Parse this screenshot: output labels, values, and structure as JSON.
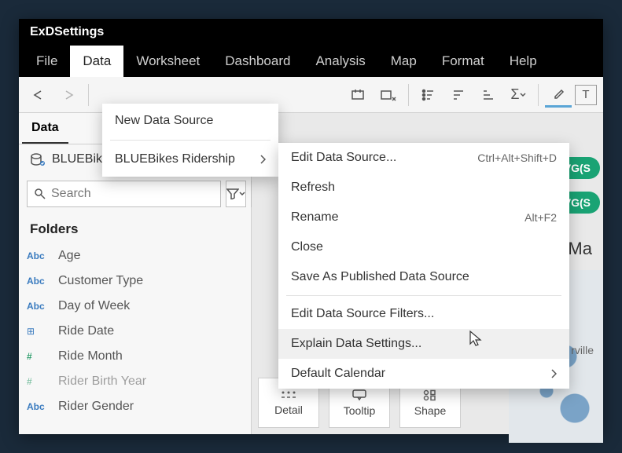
{
  "window": {
    "title": "ExDSettings"
  },
  "menubar": [
    "File",
    "Data",
    "Worksheet",
    "Dashboard",
    "Analysis",
    "Map",
    "Format",
    "Help"
  ],
  "menubar_active_index": 1,
  "sidebar": {
    "tab": "Data",
    "datasource": "BLUEBikes Ridership",
    "search_placeholder": "Search",
    "folders_label": "Folders",
    "fields": [
      {
        "type": "Abc",
        "cls": "abc",
        "label": "Age"
      },
      {
        "type": "Abc",
        "cls": "abc",
        "label": "Customer Type"
      },
      {
        "type": "Abc",
        "cls": "abc",
        "label": "Day of Week"
      },
      {
        "type": "⊞",
        "cls": "date",
        "label": "Ride Date"
      },
      {
        "type": "#",
        "cls": "hash",
        "label": "Ride Month"
      },
      {
        "type": "#",
        "cls": "hash",
        "label": "Rider Birth Year"
      },
      {
        "type": "Abc",
        "cls": "abc",
        "label": "Rider Gender"
      }
    ]
  },
  "data_menu": {
    "items": [
      {
        "label": "New Data Source"
      },
      {
        "label": "BLUEBikes Ridership",
        "submenu": true
      }
    ]
  },
  "submenu": {
    "items": [
      {
        "label": "Edit Data Source...",
        "shortcut": "Ctrl+Alt+Shift+D"
      },
      {
        "label": "Refresh"
      },
      {
        "label": "Rename",
        "shortcut": "Alt+F2"
      },
      {
        "label": "Close"
      },
      {
        "label": "Save As Published Data Source"
      },
      {
        "sep": true
      },
      {
        "label": "Edit Data Source Filters..."
      },
      {
        "label": "Explain Data Settings...",
        "hover": true
      },
      {
        "label": "Default Calendar",
        "submenu": true
      }
    ]
  },
  "main": {
    "pills": [
      "AVG(S",
      "AVG(S"
    ],
    "viz_title_fragment": "e Ma",
    "map_label": "rville",
    "marks": [
      "Detail",
      "Tooltip",
      "Shape"
    ]
  }
}
